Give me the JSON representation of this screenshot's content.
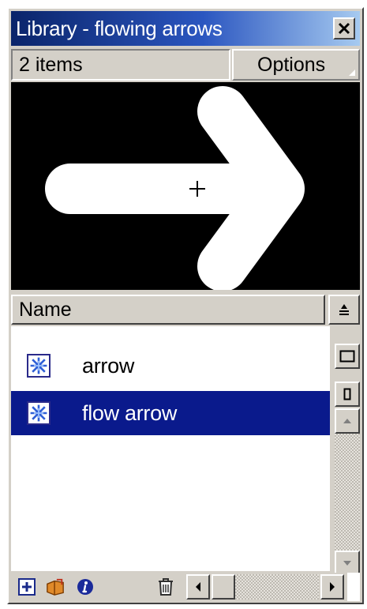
{
  "window": {
    "title": "Library - flowing arrows",
    "close_icon": "close-x-icon"
  },
  "info": {
    "item_count": "2 items",
    "options_label": "Options"
  },
  "preview": {
    "symbol": "arrow",
    "background": "#000000",
    "shape_color": "#ffffff"
  },
  "columns": {
    "name_header": "Name",
    "sort_icon": "sort-order-icon"
  },
  "items": [
    {
      "label": "arrow",
      "icon": "graphic-symbol-icon",
      "selected": false
    },
    {
      "label": "flow arrow",
      "icon": "graphic-symbol-icon",
      "selected": true
    }
  ],
  "side_buttons": [
    "wide-state-icon",
    "narrow-state-icon"
  ],
  "toolbar": {
    "icons": [
      "new-symbol-icon",
      "new-folder-icon",
      "properties-icon",
      "delete-icon"
    ]
  },
  "colors": {
    "title_start": "#0a246a",
    "title_end": "#a6caf0",
    "selection": "#0a1a8c",
    "chrome": "#d4d0c8"
  }
}
